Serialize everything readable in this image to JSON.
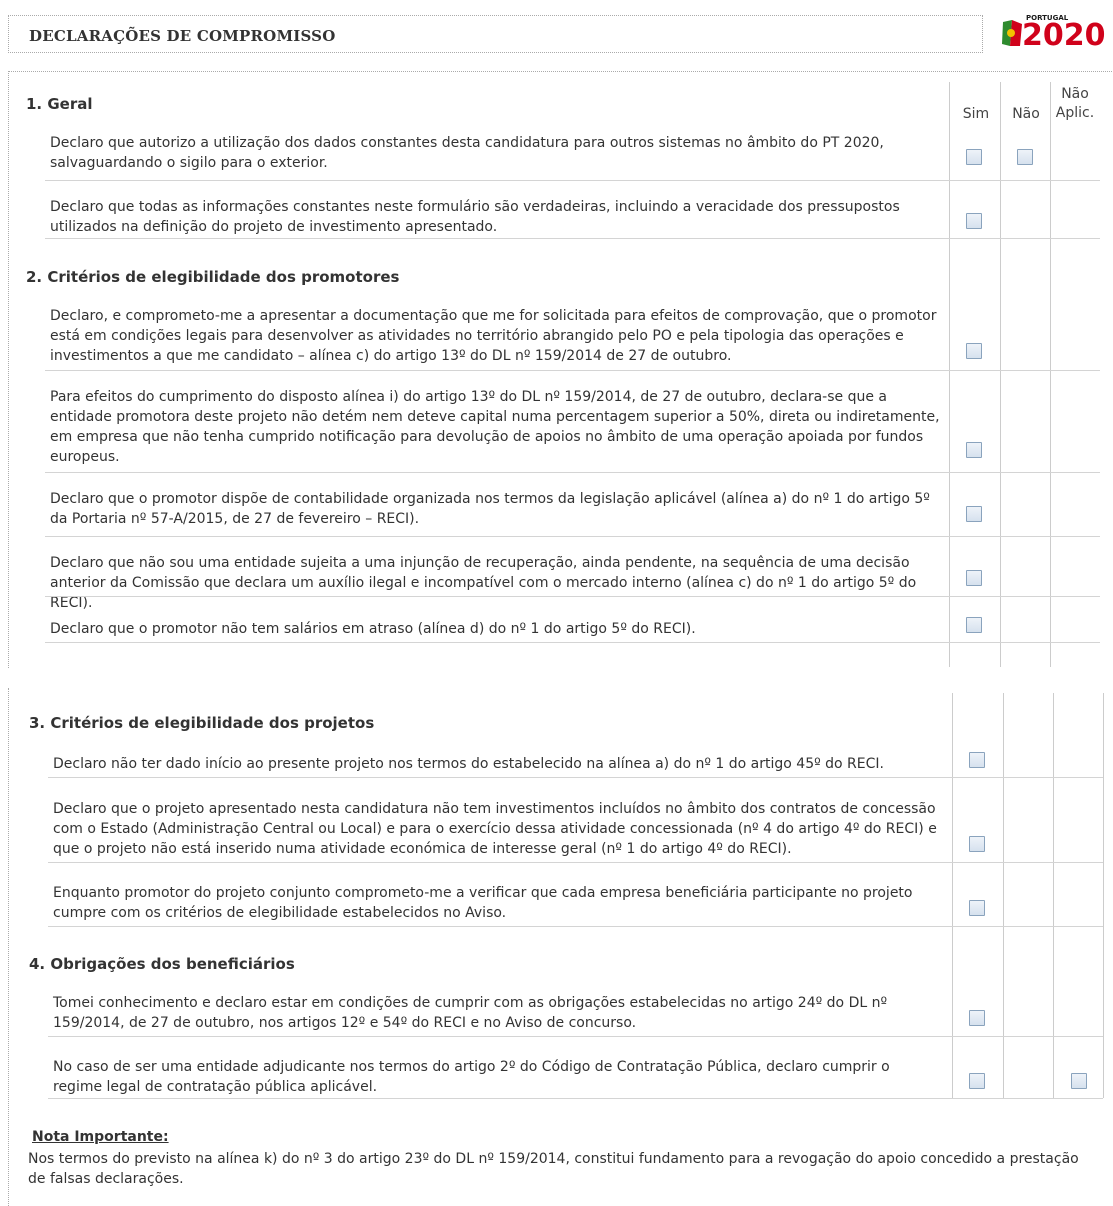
{
  "header": {
    "title": "DECLARAÇÕES DE COMPROMISSO",
    "logo_small": "PORTUGAL",
    "logo_year": "2020"
  },
  "columns": {
    "sim": "Sim",
    "nao": "Não",
    "nao_aplic_1": "Não",
    "nao_aplic_2": "Aplic."
  },
  "sections": [
    {
      "title": "1. Geral",
      "items": [
        {
          "text": "Declaro que autorizo a utilização dos dados constantes desta candidatura para outros sistemas no âmbito do PT 2020, salvaguardando o sigilo para o exterior.",
          "sim": false,
          "nao": false
        },
        {
          "text": "Declaro que todas as informações constantes neste formulário são verdadeiras, incluindo a veracidade dos pressupostos utilizados na definição do projeto de investimento apresentado.",
          "sim": false
        }
      ]
    },
    {
      "title": "2. Critérios de elegibilidade dos promotores",
      "items": [
        {
          "text": "Declaro, e comprometo-me a apresentar a documentação que me for solicitada para efeitos de comprovação, que o promotor está em condições legais para desenvolver as atividades no território abrangido pelo PO e pela tipologia das operações e investimentos a que me candidato – alínea c) do artigo 13º do DL nº 159/2014 de 27 de outubro.",
          "sim": false
        },
        {
          "text": "Para efeitos do cumprimento do disposto alínea i) do artigo 13º do DL nº 159/2014, de 27 de outubro, declara-se que a entidade promotora deste projeto não detém nem deteve capital numa percentagem superior a 50%, direta ou indiretamente, em empresa que não tenha cumprido notificação para devolução de apoios no âmbito de uma operação apoiada por fundos europeus.",
          "sim": false
        },
        {
          "text": "Declaro que o promotor dispõe de contabilidade organizada nos termos da legislação aplicável (alínea a) do nº 1 do artigo 5º da Portaria nº 57-A/2015, de 27 de fevereiro – RECI).",
          "sim": false
        },
        {
          "text": "Declaro que não sou uma entidade sujeita a uma injunção de recuperação, ainda pendente, na sequência de uma decisão anterior da Comissão que declara um auxílio ilegal e incompatível com o mercado interno (alínea c) do nº 1 do artigo 5º do RECI).",
          "sim": false
        },
        {
          "text": "Declaro que o promotor não tem salários em atraso (alínea d) do nº 1 do artigo 5º do RECI).",
          "sim": false
        }
      ]
    },
    {
      "title": "3. Critérios de elegibilidade dos projetos",
      "items": [
        {
          "text": "Declaro não ter dado início ao presente projeto nos termos do estabelecido na alínea a) do nº 1 do artigo 45º do RECI.",
          "sim": false
        },
        {
          "text": "Declaro que o projeto apresentado nesta candidatura não tem investimentos incluídos no âmbito dos contratos de concessão com o Estado (Administração Central ou Local) e para o exercício dessa atividade concessionada (nº 4 do artigo 4º do RECI) e que o projeto não está inserido numa atividade económica de interesse geral (nº 1 do artigo 4º do RECI).",
          "sim": false
        },
        {
          "text": "Enquanto promotor do projeto conjunto comprometo-me a verificar que cada empresa beneficiária participante no projeto cumpre com os critérios de elegibilidade estabelecidos no Aviso.",
          "sim": false
        }
      ]
    },
    {
      "title": "4. Obrigações dos beneficiários",
      "items": [
        {
          "text": "Tomei conhecimento e declaro estar em condições de cumprir com as obrigações estabelecidas no artigo 24º do DL nº 159/2014, de 27 de outubro, nos artigos 12º e 54º do RECI e no Aviso de concurso.",
          "sim": false
        },
        {
          "text": "No caso de ser uma entidade adjudicante nos termos do artigo 2º do Código de Contratação Pública, declaro cumprir o regime legal de contratação pública aplicável.",
          "sim": false,
          "nao_aplic": false
        }
      ]
    }
  ],
  "note": {
    "title": "Nota Importante:",
    "text": "Nos termos do previsto na alínea k) do nº 3 do artigo 23º do DL nº 159/2014, constitui fundamento para a revogação do apoio concedido a prestação de falsas declarações."
  }
}
